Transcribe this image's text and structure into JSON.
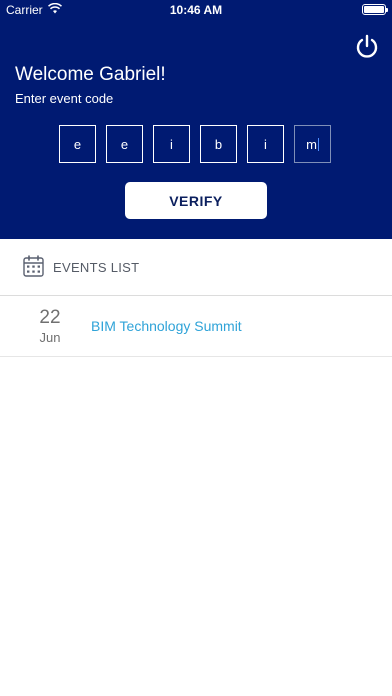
{
  "status": {
    "carrier": "Carrier",
    "time": "10:46 AM"
  },
  "header": {
    "welcome": "Welcome Gabriel!",
    "prompt": "Enter event code",
    "code": [
      "e",
      "e",
      "i",
      "b",
      "i",
      "m"
    ],
    "verify_label": "VERIFY",
    "bg_color": "#001a72"
  },
  "events": {
    "title": "EVENTS LIST",
    "items": [
      {
        "day": "22",
        "month": "Jun",
        "name": "BIM Technology Summit"
      }
    ]
  }
}
